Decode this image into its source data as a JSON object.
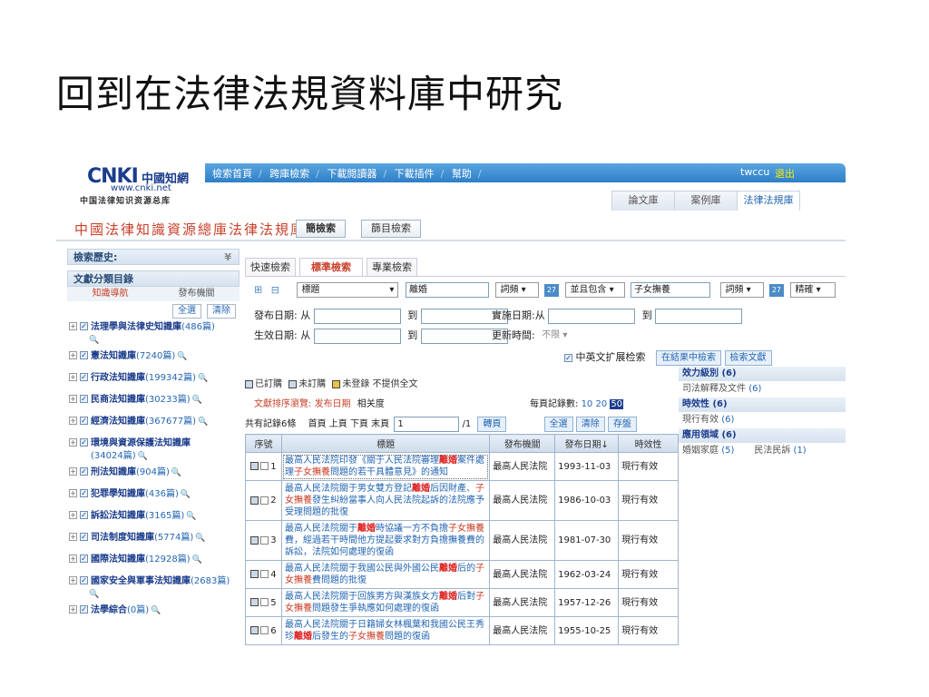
{
  "slide_title": "回到在法律法規資料庫中研究",
  "logo": {
    "main": "CNKI",
    "cn": "中國知網",
    "url": "www.cnki.net",
    "sub": "中国法律知识资源总库"
  },
  "nav": [
    "檢索首頁",
    "跨庫檢索",
    "下載閱讀器",
    "下載插件",
    "幫助"
  ],
  "user": "twccu",
  "logout": "退出",
  "db_tabs": [
    "論文庫",
    "案例庫",
    "法律法規庫"
  ],
  "brand": "中國法律知識資源總庫法律法規庫",
  "btn_simple": "簡檢索",
  "btn_biblio": "篩目檢索",
  "sidebar": {
    "history_label": "檢索歷史:",
    "catalog_label": "文獻分類目錄",
    "tab_knowledge": "知識導航",
    "tab_agency": "發布機關",
    "select_all": "全選",
    "clear": "清除",
    "cats": [
      {
        "name": "法理學與法律史知識庫",
        "count": "(486篇)"
      },
      {
        "name": "憲法知識庫",
        "count": "(7240篇)"
      },
      {
        "name": "行政法知識庫",
        "count": "(199342篇)"
      },
      {
        "name": "民商法知識庫",
        "count": "(30233篇)"
      },
      {
        "name": "經濟法知識庫",
        "count": "(367677篇)"
      },
      {
        "name": "環境與資源保護法知識庫",
        "count": "(34024篇)"
      },
      {
        "name": "刑法知識庫",
        "count": "(904篇)"
      },
      {
        "name": "犯罪學知識庫",
        "count": "(436篇)"
      },
      {
        "name": "訴訟法知識庫",
        "count": "(3165篇)"
      },
      {
        "name": "司法制度知識庫",
        "count": "(5774篇)"
      },
      {
        "name": "國際法知識庫",
        "count": "(12928篇)"
      },
      {
        "name": "國家安全與軍事法知識庫",
        "count": "(2683篇)"
      },
      {
        "name": "法學綜合",
        "count": "(0篇)"
      }
    ]
  },
  "search": {
    "tabs": [
      "快速檢索",
      "標準檢索",
      "專業檢索"
    ],
    "field1": "標題",
    "value1": "離婚",
    "freq1": "詞頻",
    "logic": "並且包含",
    "value2": "子女撫養",
    "freq2": "詞頻",
    "match": "精確",
    "pub_date_label": "發布日期:",
    "from": "从",
    "to": "到",
    "eff_date_label": "生效日期:",
    "impl_date_label": "實施日期:",
    "upd_time_label": "更新時間:",
    "upd_value": "不限",
    "ext_label": "中英文扩展检索",
    "btn_in_result": "在結果中檢索",
    "btn_search": "檢索文獻"
  },
  "legend": {
    "subscribed": "已訂購",
    "unsubscribed": "未訂購",
    "notlogged": "未登錄",
    "nofull": "不提供全文"
  },
  "sort": {
    "label": "文獻排序瀏覽:",
    "by_date": "发布日期",
    "relevance": "相关度",
    "per_page_label": "每頁記錄數:",
    "opt10": "10",
    "opt20": "20",
    "opt50": "50"
  },
  "pager": {
    "total": "共有記錄6條",
    "first": "首頁",
    "prev": "上頁",
    "next": "下頁",
    "last": "末頁",
    "page_value": "1",
    "page_total": "/1",
    "goto": "轉頁",
    "sel_all": "全選",
    "clear": "清除",
    "save": "存盤"
  },
  "table": {
    "headers": [
      "序號",
      "標題",
      "發布機關",
      "發布日期↓",
      "時效性"
    ],
    "rows": [
      {
        "no": "1",
        "pre": "最高人民法院印發《關于人民法院審理",
        "kw1": "離婚",
        "mid": "案件處理",
        "kw2": "子女撫養",
        "post": "問題的若干具體意見》的通知",
        "agency": "最高人民法院",
        "date": "1993-11-03",
        "valid": "現行有效"
      },
      {
        "no": "2",
        "pre": "最高人民法院關于男女雙方登記",
        "kw1": "離婚",
        "mid": "后因財產、",
        "kw2": "子女撫養",
        "post": "發生糾紛當事人向人民法院起訴的法院應予受理問題的批復",
        "agency": "最高人民法院",
        "date": "1986-10-03",
        "valid": "現行有效"
      },
      {
        "no": "3",
        "pre": "最高人民法院關于",
        "kw1": "離婚",
        "mid": "時協議一方不負擔",
        "kw2": "子女撫養",
        "post": "費，經過若干時間他方提起要求對方負擔撫養費的訴訟，法院如何處理的復函",
        "agency": "最高人民法院",
        "date": "1981-07-30",
        "valid": "現行有效"
      },
      {
        "no": "4",
        "pre": "最高人民法院關于我國公民與外國公民",
        "kw1": "離婚",
        "mid": "后的",
        "kw2": "子女撫養",
        "post": "費問題的批復",
        "agency": "最高人民法院",
        "date": "1962-03-24",
        "valid": "現行有效"
      },
      {
        "no": "5",
        "pre": "最高人民法院關于回族男方與漢族女方",
        "kw1": "離婚",
        "mid": "后對",
        "kw2": "子女撫養",
        "post": "問題發生爭執應如何處理的復函",
        "agency": "最高人民法院",
        "date": "1957-12-26",
        "valid": "現行有效"
      },
      {
        "no": "6",
        "pre": "最高人民法院關于日籍婦女林楓葉和我國公民王秀珍",
        "kw1": "離婚",
        "mid": "后發生的",
        "kw2": "子女撫養",
        "post": "問題的復函",
        "agency": "最高人民法院",
        "date": "1955-10-25",
        "valid": "現行有效"
      }
    ]
  },
  "facets": {
    "f1_head": "效力級別 (6)",
    "f1_item": "司法解釋及文件",
    "f1_count": "(6)",
    "f2_head": "時效性 (6)",
    "f2_item": "現行有效",
    "f2_count": "(6)",
    "f3_head": "應用領域 (6)",
    "f3_item_a": "婚姻家庭",
    "f3_count_a": "(5)",
    "f3_item_b": "民法民訴",
    "f3_count_b": "(1)"
  }
}
